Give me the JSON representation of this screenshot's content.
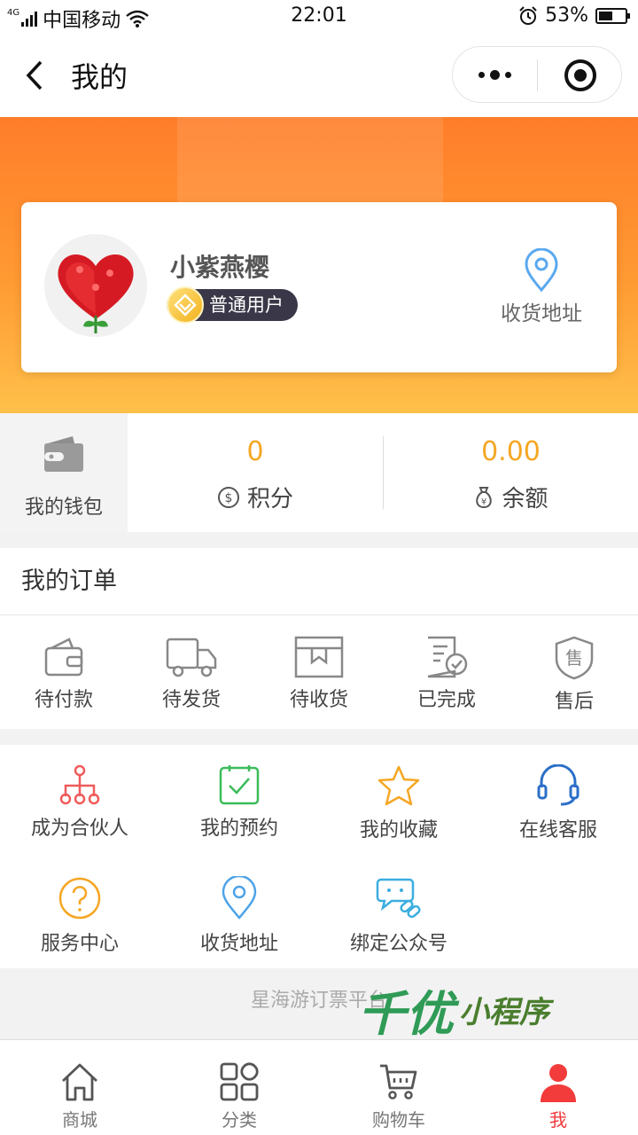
{
  "status_bar": {
    "network_type": "4G",
    "carrier": "中国移动",
    "time": "22:01",
    "battery": "53%",
    "battery_level": 0.53
  },
  "header": {
    "title": "我的"
  },
  "profile": {
    "name": "小紫燕樱",
    "level": "普通用户",
    "address_label": "收货地址"
  },
  "wallet": {
    "label": "我的钱包",
    "points": {
      "value": "0",
      "label": "积分"
    },
    "balance": {
      "value": "0.00",
      "label": "余额"
    }
  },
  "orders": {
    "title": "我的订单",
    "items": [
      {
        "label": "待付款",
        "icon": "wallet-icon"
      },
      {
        "label": "待发货",
        "icon": "truck-icon"
      },
      {
        "label": "待收货",
        "icon": "package-icon"
      },
      {
        "label": "已完成",
        "icon": "document-check-icon"
      },
      {
        "label": "售后",
        "icon": "shield-icon"
      }
    ]
  },
  "services": {
    "items": [
      {
        "label": "成为合伙人",
        "icon": "network-icon",
        "color": "#f05b5b"
      },
      {
        "label": "我的预约",
        "icon": "calendar-check-icon",
        "color": "#3cbc5a"
      },
      {
        "label": "我的收藏",
        "icon": "star-icon",
        "color": "#f5a623"
      },
      {
        "label": "在线客服",
        "icon": "headset-icon",
        "color": "#2b6fc7"
      },
      {
        "label": "服务中心",
        "icon": "question-icon",
        "color": "#f5a623"
      },
      {
        "label": "收货地址",
        "icon": "location-pin-icon",
        "color": "#4da3e8"
      },
      {
        "label": "绑定公众号",
        "icon": "chat-link-icon",
        "color": "#3aaee0"
      }
    ]
  },
  "footer": {
    "text": "星海游订票平台",
    "watermark_main": "千优",
    "watermark_sub": "小程序"
  },
  "tabbar": {
    "items": [
      {
        "label": "商城",
        "icon": "home-icon"
      },
      {
        "label": "分类",
        "icon": "category-icon"
      },
      {
        "label": "购物车",
        "icon": "cart-icon"
      },
      {
        "label": "我",
        "icon": "user-icon",
        "active": true
      }
    ]
  },
  "colors": {
    "accent_orange": "#ff8a2a",
    "value_gold": "#f5a623",
    "active_red": "#f23b3b"
  }
}
